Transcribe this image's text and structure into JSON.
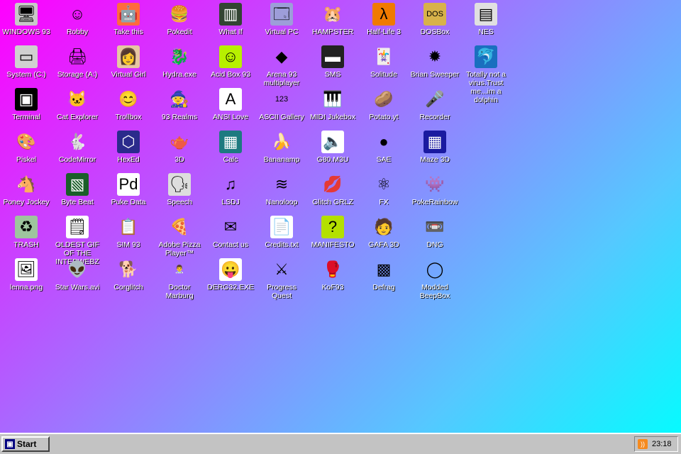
{
  "desktop": {
    "icons": [
      {
        "label": "WINDOWS 93",
        "glyph": "🖥",
        "bg": "#c8c8c8"
      },
      {
        "label": "System (C:)",
        "glyph": "▭",
        "bg": "#d0d0d0"
      },
      {
        "label": "Terminal",
        "glyph": "▣",
        "bg": "#000000"
      },
      {
        "label": "Piskel",
        "glyph": "🎨",
        "bg": "transparent"
      },
      {
        "label": "Poney Jockey",
        "glyph": "🐴",
        "bg": "transparent"
      },
      {
        "label": "TRASH",
        "glyph": "♻",
        "bg": "#9ec49e"
      },
      {
        "label": "lenna.png",
        "glyph": "🖼",
        "bg": "#ffffff"
      },
      {
        "label": "Robby",
        "glyph": "☺",
        "bg": "transparent"
      },
      {
        "label": "Storage (A:)",
        "glyph": "🖨",
        "bg": "transparent"
      },
      {
        "label": "Cat Explorer",
        "glyph": "🐱",
        "bg": "transparent"
      },
      {
        "label": "CodeMirror",
        "glyph": "🐇",
        "bg": "transparent"
      },
      {
        "label": "Byte Beat",
        "glyph": "▧",
        "bg": "#1a5e2a"
      },
      {
        "label": "OLDEST GIF OF THE INTERWEBZ",
        "glyph": "🗒",
        "bg": "#ffffff"
      },
      {
        "label": "Star Wars.avi",
        "glyph": "👽",
        "bg": "transparent"
      },
      {
        "label": "Take this",
        "glyph": "🤖",
        "bg": "#ff6a3d"
      },
      {
        "label": "Virtual Girl",
        "glyph": "👩",
        "bg": "#e6c6a2"
      },
      {
        "label": "Trollbox",
        "glyph": "😊",
        "bg": "transparent"
      },
      {
        "label": "HexEd",
        "glyph": "⬡",
        "bg": "#2b2b8c"
      },
      {
        "label": "Puke Data",
        "glyph": "Pd",
        "bg": "#ffffff"
      },
      {
        "label": "SIM 93",
        "glyph": "📋",
        "bg": "transparent"
      },
      {
        "label": "Corglitch",
        "glyph": "🐕",
        "bg": "transparent"
      },
      {
        "label": "Pokedit",
        "glyph": "🍔",
        "bg": "transparent"
      },
      {
        "label": "Hydra.exe",
        "glyph": "🐉",
        "bg": "transparent"
      },
      {
        "label": "93 Realms",
        "glyph": "🧙",
        "bg": "transparent"
      },
      {
        "label": "3D",
        "glyph": "🫖",
        "bg": "transparent"
      },
      {
        "label": "Speech",
        "glyph": "🗣",
        "bg": "#dddddd"
      },
      {
        "label": "Adobe Pizza Player™",
        "glyph": "🍕",
        "bg": "transparent"
      },
      {
        "label": "Doctor Marburg",
        "glyph": "👨‍⚕",
        "bg": "transparent"
      },
      {
        "label": "What If",
        "glyph": "▥",
        "bg": "#334433"
      },
      {
        "label": "Acid Box 93",
        "glyph": "☺",
        "bg": "#b7f000"
      },
      {
        "label": "ANSI Love",
        "glyph": "A",
        "bg": "#ffffff"
      },
      {
        "label": "Calc",
        "glyph": "▦",
        "bg": "#1d7a80"
      },
      {
        "label": "LSDJ",
        "glyph": "♫",
        "bg": "transparent"
      },
      {
        "label": "Contact us",
        "glyph": "✉",
        "bg": "transparent"
      },
      {
        "label": "DERG32.EXE",
        "glyph": "😛",
        "bg": "#ffffff"
      },
      {
        "label": "Virtual PC",
        "glyph": "🗔",
        "bg": "#9d9dd9"
      },
      {
        "label": "Arena 93 multiplayer",
        "glyph": "◆",
        "bg": "transparent"
      },
      {
        "label": "ASCII Gallery",
        "glyph": "123",
        "bg": "transparent"
      },
      {
        "label": "Bananamp",
        "glyph": "🍌",
        "bg": "transparent"
      },
      {
        "label": "Nanoloop",
        "glyph": "≋",
        "bg": "transparent"
      },
      {
        "label": "Credits.txt",
        "glyph": "📄",
        "bg": "#ffffff"
      },
      {
        "label": "Progress Quest",
        "glyph": "⚔",
        "bg": "transparent"
      },
      {
        "label": "HAMPSTER",
        "glyph": "🐹",
        "bg": "transparent"
      },
      {
        "label": "SMS",
        "glyph": "▬",
        "bg": "#222222"
      },
      {
        "label": "MIDI Jukebox",
        "glyph": "🎹",
        "bg": "transparent"
      },
      {
        "label": "G80.M3U",
        "glyph": "🔈",
        "bg": "#ffffff"
      },
      {
        "label": "Glitch GRLZ",
        "glyph": "💋",
        "bg": "transparent"
      },
      {
        "label": "MANIFESTO",
        "glyph": "?",
        "bg": "#b4e000"
      },
      {
        "label": "KoF93",
        "glyph": "🥊",
        "bg": "transparent"
      },
      {
        "label": "Half-Life 3",
        "glyph": "λ",
        "bg": "#f07a00"
      },
      {
        "label": "Solitude",
        "glyph": "🃏",
        "bg": "transparent"
      },
      {
        "label": "Potato.yt",
        "glyph": "🥔",
        "bg": "transparent"
      },
      {
        "label": "SAE",
        "glyph": "●",
        "bg": "transparent"
      },
      {
        "label": "FX",
        "glyph": "⚛",
        "bg": "transparent"
      },
      {
        "label": "GAFA 3D",
        "glyph": "🧑",
        "bg": "transparent"
      },
      {
        "label": "Defrag",
        "glyph": "▩",
        "bg": "transparent"
      },
      {
        "label": "DOSBox",
        "glyph": "DOS",
        "bg": "#d8b24a"
      },
      {
        "label": "Brian Sweeper",
        "glyph": "✹",
        "bg": "transparent"
      },
      {
        "label": "Recorder",
        "glyph": "🎤",
        "bg": "transparent"
      },
      {
        "label": "Maze 3D",
        "glyph": "▦",
        "bg": "#1a1aa0"
      },
      {
        "label": "PokeRainbow",
        "glyph": "👾",
        "bg": "transparent"
      },
      {
        "label": "DNG",
        "glyph": "📼",
        "bg": "transparent"
      },
      {
        "label": "Modded BeepBox",
        "glyph": "◯",
        "bg": "transparent"
      },
      {
        "label": "NES",
        "glyph": "▤",
        "bg": "#e0e0e0"
      },
      {
        "label": "Totally not a virus.Trust me...im a dolphin",
        "glyph": "🐬",
        "bg": "#1a6fbf"
      }
    ]
  },
  "taskbar": {
    "start_label": "Start",
    "clock": "23:18"
  }
}
